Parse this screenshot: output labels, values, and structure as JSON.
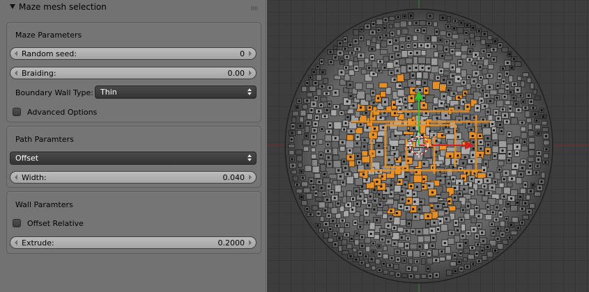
{
  "panel": {
    "title": "Maze mesh selection",
    "sections": {
      "maze": {
        "title": "Maze Parameters",
        "random_seed_label": "Random seed:",
        "random_seed_value": "0",
        "braiding_label": "Braiding:",
        "braiding_value": "0.00",
        "boundary_label": "Boundary Wall Type:",
        "boundary_value": "Thin",
        "advanced_label": "Advanced Options",
        "advanced_checked": false
      },
      "path": {
        "title": "Path Paramters",
        "method_value": "Offset",
        "width_label": "Width:",
        "width_value": "0.040"
      },
      "wall": {
        "title": "Wall Paramters",
        "offset_relative_label": "Offset Relative",
        "offset_relative_checked": false,
        "extrude_label": "Extrude:",
        "extrude_value": "0.2000"
      }
    }
  },
  "viewport": {
    "x_axis_color": "#c03030",
    "y_axis_color": "#30b030",
    "selection_color": "#f0962a",
    "mesh_color": "#8a8a8a",
    "icons": [
      "3d-cursor-icon",
      "move-gizmo-icon"
    ]
  }
}
